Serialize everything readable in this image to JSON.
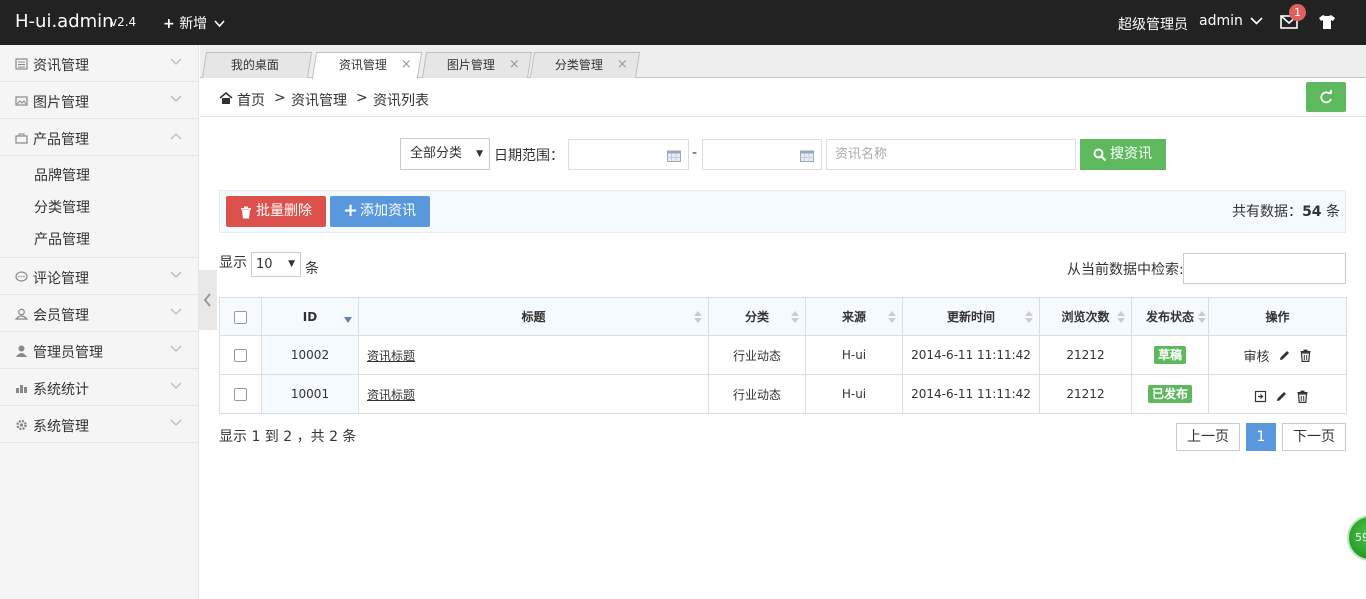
{
  "header": {
    "logo": "H-ui.admin",
    "version": "v2.4",
    "add_new": "新增",
    "role": "超级管理员",
    "username": "admin",
    "mail_badge": "1"
  },
  "sidebar": {
    "items": [
      {
        "label": "资讯管理",
        "icon": "news-icon"
      },
      {
        "label": "图片管理",
        "icon": "picture-icon"
      },
      {
        "label": "产品管理",
        "icon": "bag-icon",
        "expanded": true
      },
      {
        "label": "评论管理",
        "icon": "comment-icon"
      },
      {
        "label": "会员管理",
        "icon": "user-icon"
      },
      {
        "label": "管理员管理",
        "icon": "admin-icon"
      },
      {
        "label": "系统统计",
        "icon": "stats-icon"
      },
      {
        "label": "系统管理",
        "icon": "gear-icon"
      }
    ],
    "submenu": [
      "品牌管理",
      "分类管理",
      "产品管理"
    ]
  },
  "tabs": [
    {
      "label": "我的桌面"
    },
    {
      "label": "资讯管理",
      "active": true
    },
    {
      "label": "图片管理"
    },
    {
      "label": "分类管理"
    }
  ],
  "tab_close": "×",
  "breadcrumb": [
    "首页",
    "资讯管理",
    "资讯列表"
  ],
  "breadcrumb_sep": ">",
  "search": {
    "category": "全部分类",
    "date_label": "日期范围：",
    "date_sep": "-",
    "name_placeholder": "资讯名称",
    "button": "搜资讯"
  },
  "actions": {
    "batch_delete": "批量删除",
    "add": "添加资讯",
    "total_prefix": "共有数据：",
    "total_count": "54",
    "total_suffix": " 条"
  },
  "length": {
    "prefix": "显示",
    "value": "10",
    "suffix": "条"
  },
  "filter_label": "从当前数据中检索:",
  "table": {
    "headers": [
      "ID",
      "标题",
      "分类",
      "来源",
      "更新时间",
      "浏览次数",
      "发布状态",
      "操作"
    ],
    "rows": [
      {
        "id": "10002",
        "title": "资讯标题",
        "category": "行业动态",
        "source": "H-ui",
        "updated": "2014-6-11 11:11:42",
        "views": "21212",
        "status": "草稿",
        "op_text": "审核"
      },
      {
        "id": "10001",
        "title": "资讯标题",
        "category": "行业动态",
        "source": "H-ui",
        "updated": "2014-6-11 11:11:42",
        "views": "21212",
        "status": "已发布",
        "op_text": ""
      }
    ]
  },
  "pagination": {
    "info": "显示 1 到 2 ，共 2 条",
    "prev": "上一页",
    "current": "1",
    "next": "下一页"
  },
  "float_ball": "59",
  "colors": {
    "topbar": "#222222",
    "green": "#5eb95e",
    "red": "#dd514c",
    "blue": "#5a98de"
  }
}
